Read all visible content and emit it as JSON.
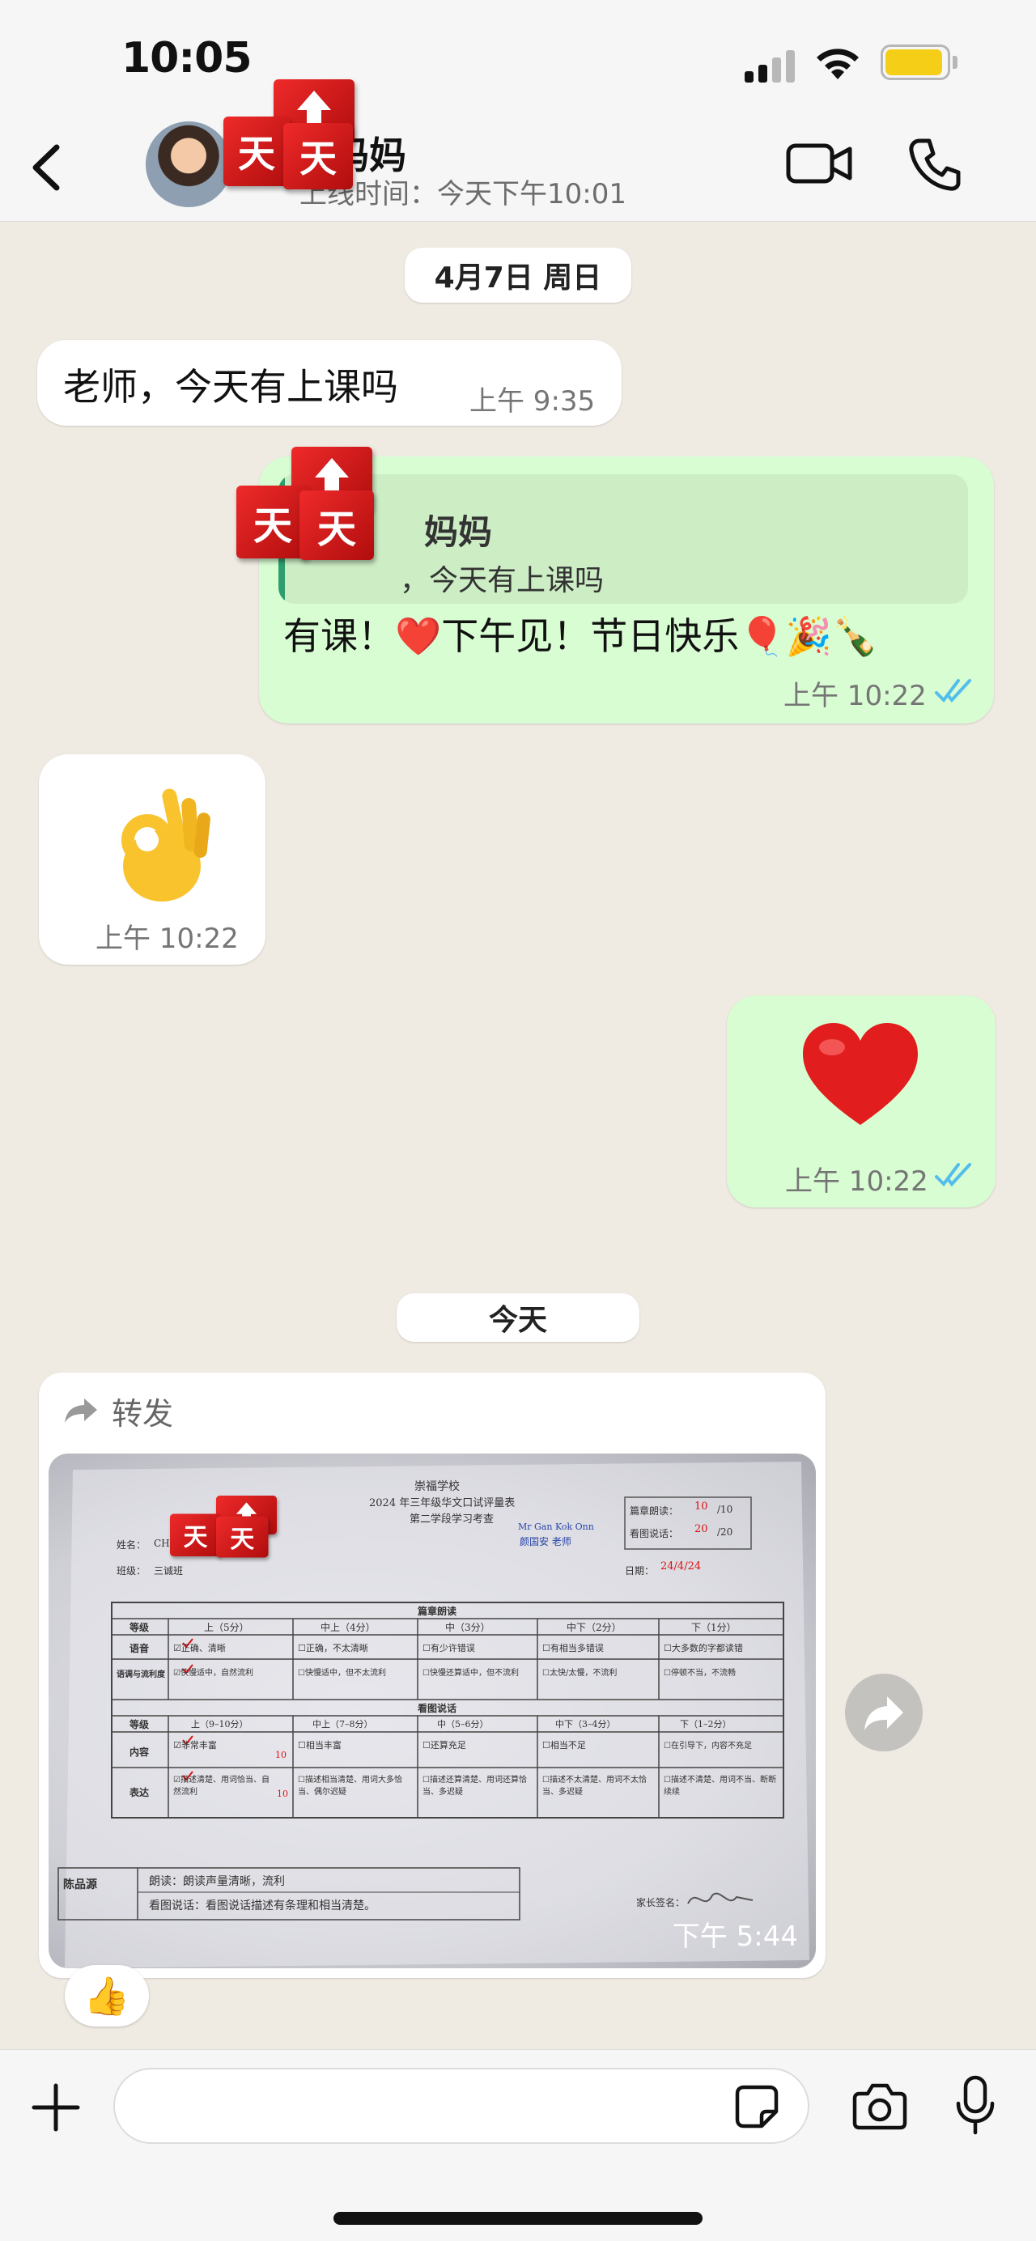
{
  "status_bar": {
    "time": "10:05",
    "battery_color": "#f5cf17"
  },
  "header": {
    "contact_name": "妈妈",
    "last_seen": "上线时间：今天下午10:01",
    "back_icon": "chevron-left-icon",
    "video_icon": "video-call-icon",
    "phone_icon": "phone-icon"
  },
  "sticker_text": [
    "天",
    "天"
  ],
  "chat": {
    "date_1": "4月7日 周日",
    "msg_1": {
      "text": "老师，今天有上课吗",
      "time": "上午 9:35"
    },
    "msg_2": {
      "quote_name": "妈妈",
      "quote_text": "，今天有上课吗",
      "text": "有课！❤️下午见！节日快乐🎈🎉🍾",
      "time": "上午 10:22"
    },
    "msg_3": {
      "emoji": "👌",
      "time": "上午 10:22"
    },
    "msg_4": {
      "emoji": "❤️",
      "time": "上午 10:22"
    },
    "date_2": "今天",
    "msg_5": {
      "forward_label": "转发",
      "time": "下午 5:44",
      "reaction": "👍",
      "document": {
        "school": "崇福学校",
        "title": "2024 年三年级华文口试评量表",
        "subtitle": "第二学段学习考查",
        "teacher_en": "Mr Gan Kok Onn",
        "teacher_cn": "颜国安 老师",
        "name_label": "姓名：",
        "name_value": "CHIN",
        "class_label": "班级：",
        "class_value": "三诚班",
        "score_read_label": "篇章朗读：",
        "score_read": "10",
        "score_read_max": "/10",
        "score_talk_label": "看图说话：",
        "score_talk": "20",
        "score_talk_max": "/20",
        "date_label": "日期：",
        "date_value": "24/4/24",
        "section_1": "篇章朗读",
        "section_2": "看图说话",
        "level_header": "等级",
        "levels_1": [
          "上（5分）",
          "中上（4分）",
          "中（3分）",
          "中下（2分）",
          "下（1分）"
        ],
        "levels_2": [
          "上（9–10分）",
          "中上（7–8分）",
          "中（5–6分）",
          "中下（3–4分）",
          "下（1–2分）"
        ],
        "row_1_label": "语音",
        "row_1": [
          "☑正确、清晰",
          "☐正确，不太清晰",
          "☐有少许错误",
          "☐有相当多错误",
          "☐大多数的字都读错"
        ],
        "row_2_label": "语调与流利度",
        "row_2": [
          "☑快慢适中，自然流利",
          "☐快慢适中，但不太流利",
          "☐快慢还算适中，但不流利",
          "☐太快/太慢，不流利",
          "☐停顿不当，不流畅"
        ],
        "row_3_label": "内容",
        "row_3": [
          "☑非常丰富",
          "☐相当丰富",
          "☐还算充足",
          "☐相当不足",
          "☐在引导下，内容不充足"
        ],
        "row_4_label": "表达",
        "row_4": [
          "☑描述清楚、用词恰当、自然流利",
          "☐描述相当清楚、用词大多恰当、偶尔迟疑",
          "☐描述还算清楚、用词还算恰当、多迟疑",
          "☐描述不太清楚、用词不太恰当、多迟疑",
          "☐描述不清楚、用词不当、断断续续"
        ],
        "mark_1": "10",
        "mark_2": "10",
        "comment_label": "陈品源",
        "comment_1": "朗读：朗读声量清晰，流利",
        "comment_2": "看图说话：看图说话描述有条理和相当清楚。",
        "parent_sign_label": "家长签名："
      }
    }
  },
  "composer": {
    "placeholder": "",
    "plus_icon": "plus-icon",
    "sticker_icon": "sticker-icon",
    "camera_icon": "camera-icon",
    "mic_icon": "microphone-icon"
  },
  "colors": {
    "chat_bg": "#efeae2",
    "outgoing_bubble": "#d9fdd3",
    "incoming_bubble": "#ffffff",
    "read_ticks": "#53bdeb",
    "sticker_red": "#e11d1d"
  }
}
